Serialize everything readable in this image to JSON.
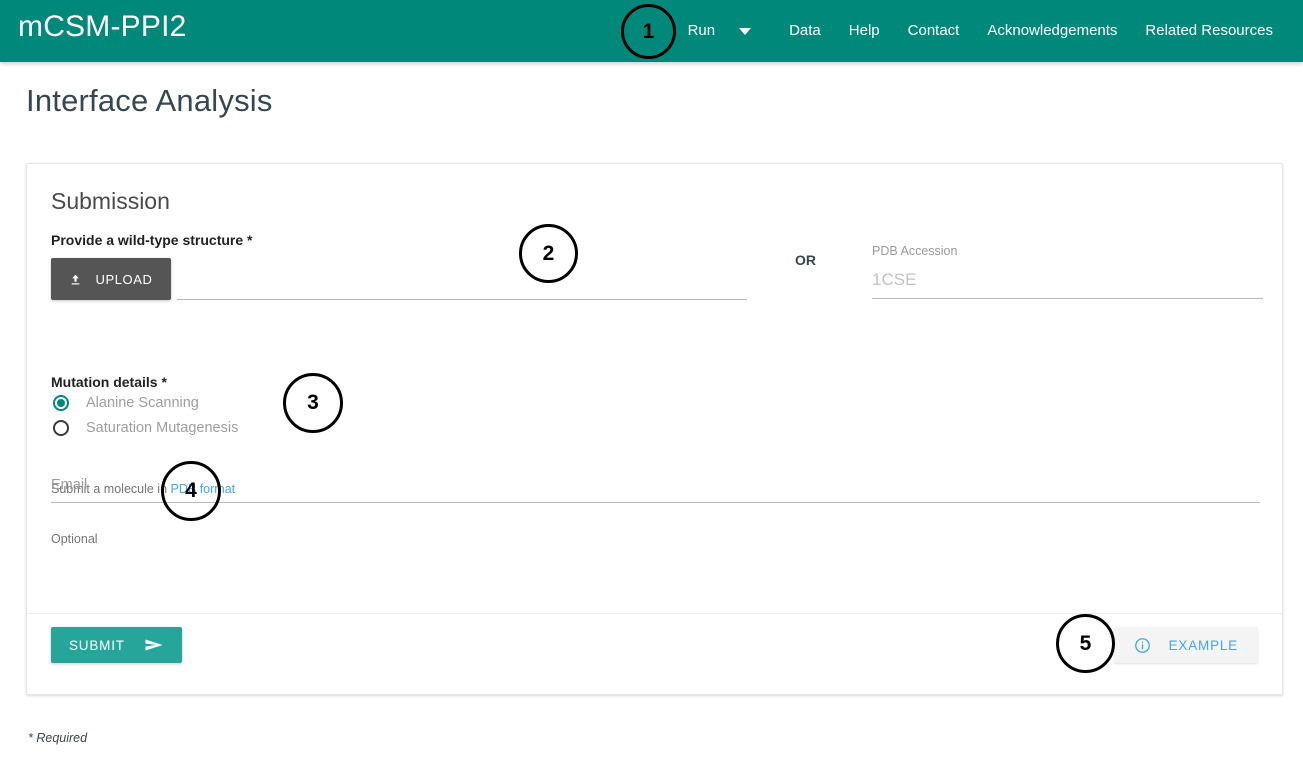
{
  "navbar": {
    "brand": "mCSM-PPI2",
    "items": [
      {
        "label": "Run",
        "has_dropdown": true
      },
      {
        "label": "Data",
        "has_dropdown": false
      },
      {
        "label": "Help",
        "has_dropdown": false
      },
      {
        "label": "Contact",
        "has_dropdown": false
      },
      {
        "label": "Acknowledgements",
        "has_dropdown": false
      },
      {
        "label": "Related Resources",
        "has_dropdown": false
      }
    ],
    "background_color": "#00897B",
    "text_color": "#ffffff"
  },
  "page": {
    "title": "Interface Analysis",
    "required_note": "* Required"
  },
  "card": {
    "section_title": "Submission",
    "structure": {
      "label": "Provide a wild-type structure *",
      "upload_button_label": "UPLOAD",
      "upload_icon": "upload-icon",
      "file_value": "",
      "helper_prefix": "Submit a molecule in ",
      "helper_link": "PDB format",
      "or_text": "OR",
      "pdb_accession_label": "PDB Accession",
      "pdb_accession_value": "",
      "pdb_accession_placeholder": "1CSE"
    },
    "mutation": {
      "label": "Mutation details *",
      "options": [
        {
          "label": "Alanine Scanning",
          "selected": true
        },
        {
          "label": "Saturation Mutagenesis",
          "selected": false
        }
      ]
    },
    "email": {
      "value": "",
      "placeholder": "Email",
      "helper": "Optional"
    },
    "footer": {
      "submit_label": "SUBMIT",
      "submit_icon": "send-icon",
      "submit_color": "#26A69A",
      "example_label": "EXAMPLE",
      "example_icon": "info-circle-icon",
      "example_color": "#45A6E5"
    }
  },
  "annotations": [
    {
      "number": "1"
    },
    {
      "number": "2"
    },
    {
      "number": "3"
    },
    {
      "number": "4"
    },
    {
      "number": "5"
    }
  ]
}
